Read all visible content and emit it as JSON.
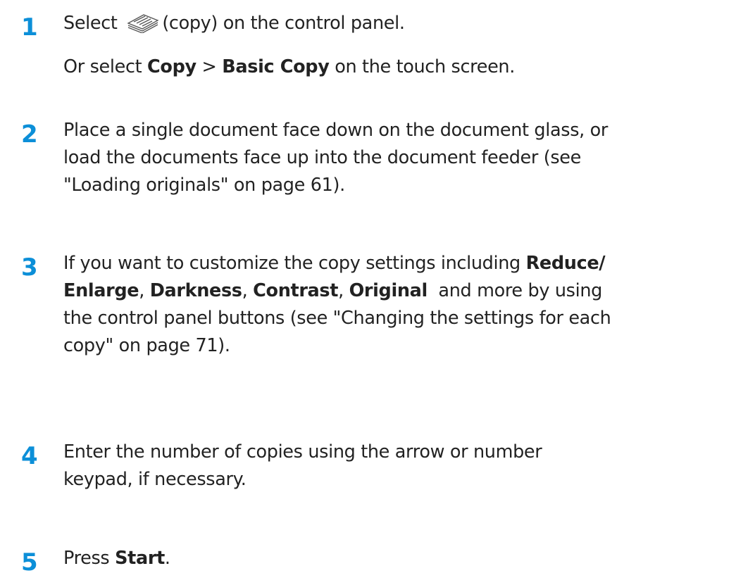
{
  "colors": {
    "step_number": "#0c8fd8",
    "text": "#222222"
  },
  "steps": [
    {
      "number": "1",
      "line1": {
        "before": "Select ",
        "icon": "copy-icon",
        "after": "(copy) on the control panel."
      },
      "line2": {
        "prefix": "Or select ",
        "bold1": "Copy",
        "sep": " > ",
        "bold2": "Basic Copy",
        "suffix": " on the touch screen."
      }
    },
    {
      "number": "2",
      "lines": [
        "Place a single document face down on the document glass, or",
        "load the documents face up into the document feeder (see",
        "\"Loading originals\" on page 61)."
      ]
    },
    {
      "number": "3",
      "line1_prefix": "If you want to customize the copy settings including ",
      "line1_bold": "Reduce/",
      "line2_bold1": "Enlarge",
      "comma": ", ",
      "line2_bold2": "Darkness",
      "line2_bold3": "Contrast",
      "line2_bold4": "Original",
      "line2_suffix": "  and more by using",
      "line3": "the control panel buttons (see \"Changing the settings for each",
      "line4": "copy\" on page 71)."
    },
    {
      "number": "4",
      "lines": [
        "Enter the number of copies using the arrow or number",
        "keypad, if necessary."
      ]
    },
    {
      "number": "5",
      "prefix": "Press ",
      "bold": "Start",
      "suffix": "."
    }
  ]
}
